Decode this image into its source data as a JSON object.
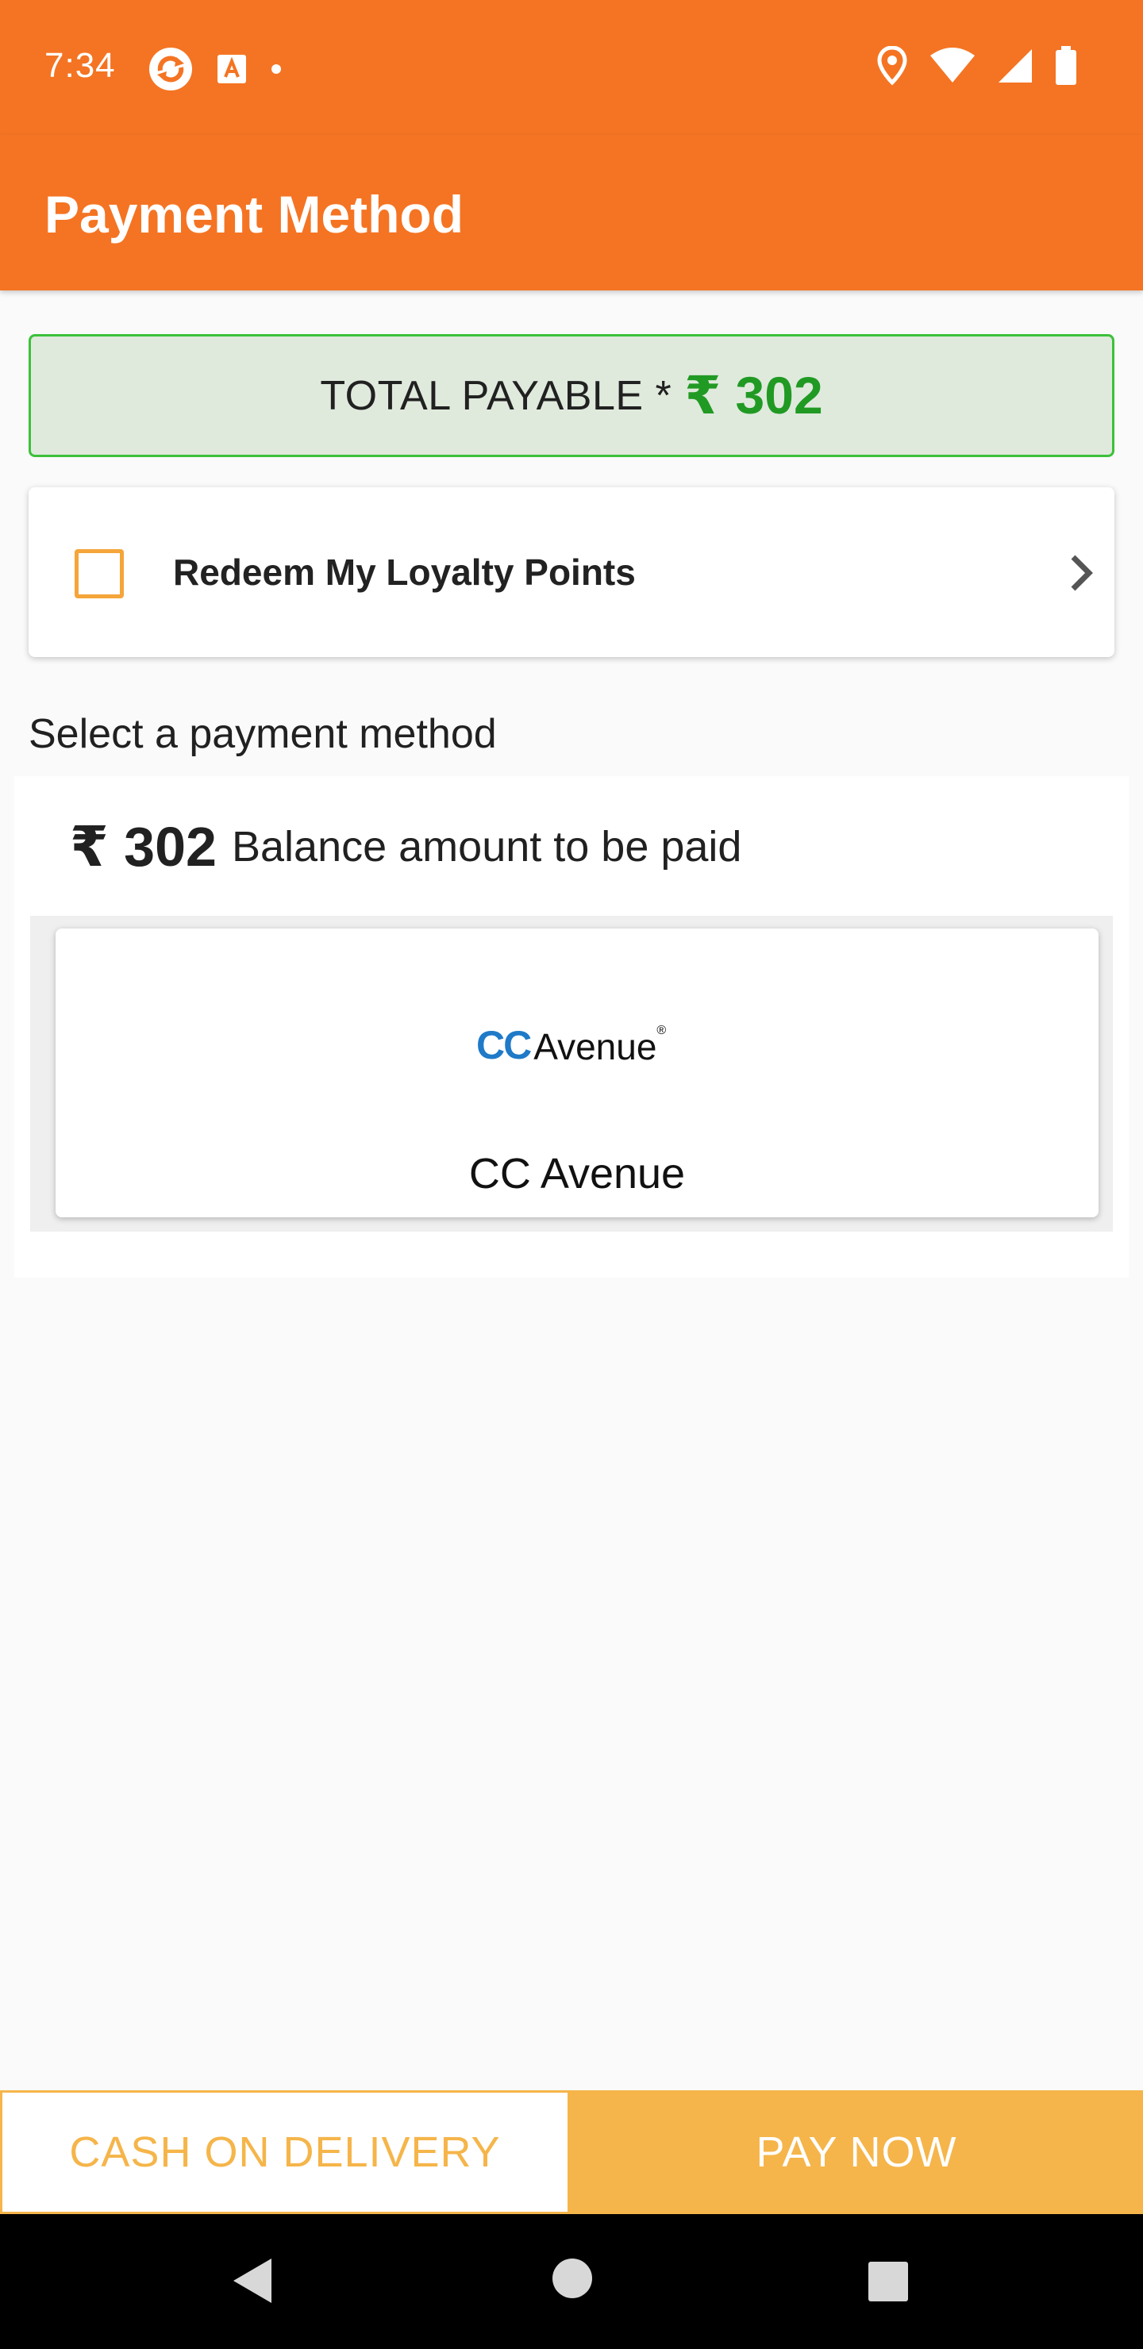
{
  "status_bar": {
    "time": "7:34",
    "left_icons": [
      "sync-icon",
      "translate-icon",
      "dot-icon"
    ],
    "right_icons": [
      "location-icon",
      "wifi-icon",
      "signal-icon",
      "battery-icon"
    ]
  },
  "app_bar": {
    "title": "Payment Method"
  },
  "total": {
    "label": "TOTAL PAYABLE *",
    "amount": "₹ 302",
    "accent": "#219a23"
  },
  "loyalty": {
    "label": "Redeem My Loyalty Points",
    "checked": false
  },
  "section": {
    "select_label": "Select a payment method"
  },
  "balance": {
    "amount": "₹ 302",
    "text": "Balance amount to be paid"
  },
  "method": {
    "logo_blue": "CC",
    "logo_black": "Avenue",
    "logo_reg": "®",
    "label": "CC Avenue"
  },
  "bottom": {
    "cod_label": "CASH ON DELIVERY",
    "pay_label": "PAY NOW"
  },
  "colors": {
    "primary": "#f47423",
    "button": "#f5b54a",
    "checkbox": "#f5a53a"
  },
  "nav": {
    "icons": [
      "back-icon",
      "home-icon",
      "recents-icon"
    ]
  }
}
